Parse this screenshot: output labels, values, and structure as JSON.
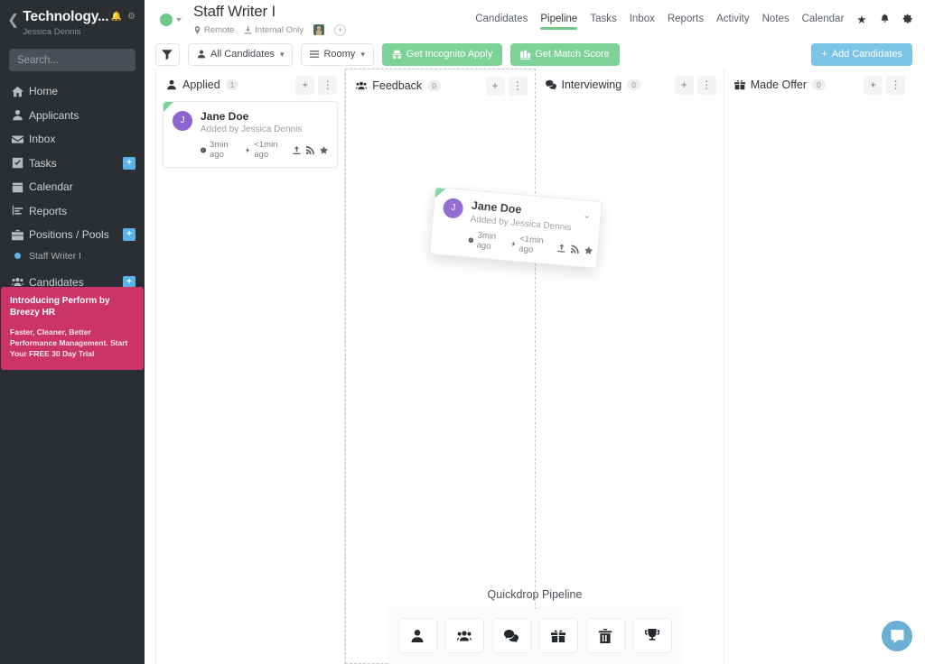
{
  "sidebar": {
    "back_icon": "chevron-left-icon",
    "company": "Technology...",
    "user": "Jessica Dennis",
    "bell_icon": "bell-icon",
    "gear_icon": "gear-icon",
    "search_placeholder": "Search...",
    "items": [
      {
        "label": "Home",
        "icon": "home-icon",
        "badge": ""
      },
      {
        "label": "Applicants",
        "icon": "person-icon",
        "badge": ""
      },
      {
        "label": "Inbox",
        "icon": "envelope-icon",
        "badge": ""
      },
      {
        "label": "Tasks",
        "icon": "check-square-icon",
        "badge": "+"
      },
      {
        "label": "Calendar",
        "icon": "calendar-icon",
        "badge": ""
      },
      {
        "label": "Reports",
        "icon": "bar-chart-icon",
        "badge": ""
      },
      {
        "label": "Positions / Pools",
        "icon": "briefcase-icon",
        "badge": "+"
      }
    ],
    "sub_item": {
      "label": "Staff Writer I",
      "dot_color": "#5bb4e5"
    },
    "candidates_item": {
      "label": "Candidates",
      "icon": "people-icon",
      "badge": "+"
    },
    "promo": {
      "title": "Introducing Perform by Breezy HR",
      "body": "Faster, Cleaner, Better Performance Management. Start Your FREE 30 Day Trial",
      "color": "#cc3366"
    }
  },
  "header": {
    "status_color": "#6ec98b",
    "job_title": "Staff Writer I",
    "meta": [
      {
        "label": "Remote",
        "icon": "location-pin-icon"
      },
      {
        "label": "Internal Only",
        "icon": "download-icon"
      }
    ],
    "avatar_icon": "user-avatar",
    "add_person_label": "+",
    "nav": [
      {
        "label": "Candidates",
        "active": false
      },
      {
        "label": "Pipeline",
        "active": true
      },
      {
        "label": "Tasks",
        "active": false
      },
      {
        "label": "Inbox",
        "active": false
      },
      {
        "label": "Reports",
        "active": false
      },
      {
        "label": "Activity",
        "active": false
      },
      {
        "label": "Notes",
        "active": false
      },
      {
        "label": "Calendar",
        "active": false
      }
    ],
    "nav_icons": [
      {
        "icon": "star-icon",
        "glyph": "★"
      },
      {
        "icon": "bell-icon",
        "glyph": "🔔"
      },
      {
        "icon": "gear-icon",
        "glyph": "⚙"
      }
    ],
    "accent_color": "#6ec98b"
  },
  "toolbar": {
    "filter_icon": "filter-icon",
    "candidates_filter": "All Candidates",
    "density": "Roomy",
    "incognito_label": "Get Incognito Apply",
    "match_score_label": "Get Match Score",
    "add_candidates_label": "Add Candidates",
    "green": "#7dd396",
    "blue": "#7cc3e8"
  },
  "board": {
    "columns": [
      {
        "name": "Applied",
        "count": "1",
        "icon": "person-icon",
        "drop": false
      },
      {
        "name": "Feedback",
        "count": "0",
        "icon": "people-icon",
        "drop": true
      },
      {
        "name": "Interviewing",
        "count": "0",
        "icon": "chat-icon",
        "drop": false
      },
      {
        "name": "Made Offer",
        "count": "0",
        "icon": "gift-icon",
        "drop": false
      }
    ],
    "add_icon": "plus-icon",
    "menu_icon": "kebab-menu-icon",
    "card": {
      "initial": "J",
      "name": "Jane Doe",
      "added_by": "Added by Jessica Dennis",
      "time_label": "3min ago",
      "activity_label": "<1min ago",
      "avatar_color": "#8c62cf",
      "flag_color": "#7dd396",
      "actions": [
        "upload-icon",
        "signal-icon",
        "star-icon"
      ]
    }
  },
  "quickdrop": {
    "title": "Quickdrop Pipeline",
    "buttons": [
      {
        "icon": "person-icon"
      },
      {
        "icon": "people-icon"
      },
      {
        "icon": "chat-icon"
      },
      {
        "icon": "gift-icon"
      },
      {
        "icon": "trash-icon"
      },
      {
        "icon": "trophy-icon"
      }
    ]
  },
  "chat": {
    "icon": "chat-bubble-icon",
    "color": "#6bafd6"
  }
}
